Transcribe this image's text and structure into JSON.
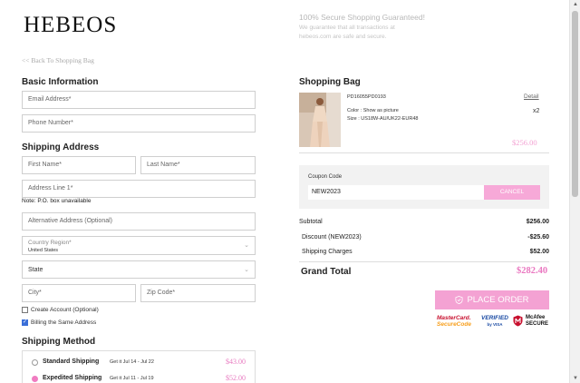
{
  "brand": {
    "logo": "HEBEOS"
  },
  "secure": {
    "title": "100% Secure Shopping Guaranteed!",
    "line1": "We guarantee that all transactions at",
    "line2": "hebeos.com are safe and secure."
  },
  "back_link": "<< Back To Shopping Bag",
  "basic_info": {
    "heading": "Basic Information",
    "email_placeholder": "Email Address*",
    "phone_placeholder": "Phone Number*"
  },
  "shipping_address": {
    "heading": "Shipping Address",
    "first_name_placeholder": "First Name*",
    "last_name_placeholder": "Last Name*",
    "address1_placeholder": "Address Line 1*",
    "note": "Note: P.O. box unavailable",
    "alt_address_placeholder": "Alternative Address (Optional)",
    "country_label": "Country Region*",
    "country_value": "United States",
    "state_label": "State",
    "city_placeholder": "City*",
    "zip_placeholder": "Zip Code*",
    "create_account_label": "Create Account (Optional)",
    "create_account_checked": false,
    "billing_same_label": "Billing the Same Address",
    "billing_same_checked": true
  },
  "shipping_method": {
    "heading": "Shipping Method",
    "options": [
      {
        "name": "Standard Shipping",
        "eta": "Get it Jul 14 - Jul 22",
        "price": "$43.00",
        "selected": false
      },
      {
        "name": "Expedited Shipping",
        "eta": "Get it Jul 11 - Jul 19",
        "price": "$52.00",
        "selected": true
      }
    ]
  },
  "bag": {
    "heading": "Shopping Bag",
    "item": {
      "code": "PD16055PD0193",
      "detail_link": "Detail",
      "color": "Color :  Show as picture",
      "size": "Size :  US18W-AU/UK22-EUR48",
      "qty": "x2",
      "price": "$256.00"
    }
  },
  "coupon": {
    "label": "Coupon Code",
    "value": "NEW2023",
    "cancel_label": "CANCEL"
  },
  "summary": {
    "subtotal_label": "Subtotal",
    "subtotal_value": "$256.00",
    "discount_label": "Discount (NEW2023)",
    "discount_value": "-$25.60",
    "shipping_label": "Shipping Charges",
    "shipping_value": "$52.00",
    "grand_label": "Grand Total",
    "grand_value": "$282.40"
  },
  "place_order_label": "PLACE ORDER",
  "trust": {
    "mc_line1": "MasterCard.",
    "mc_line2": "SecureCode",
    "visa_line1": "VERIFIED",
    "visa_line2": "by VISA",
    "mcafee_line1": "McAfee",
    "mcafee_line2": "SECURE"
  },
  "colors": {
    "accent": "#f4a2d3",
    "accent_text": "#ea78c1"
  }
}
